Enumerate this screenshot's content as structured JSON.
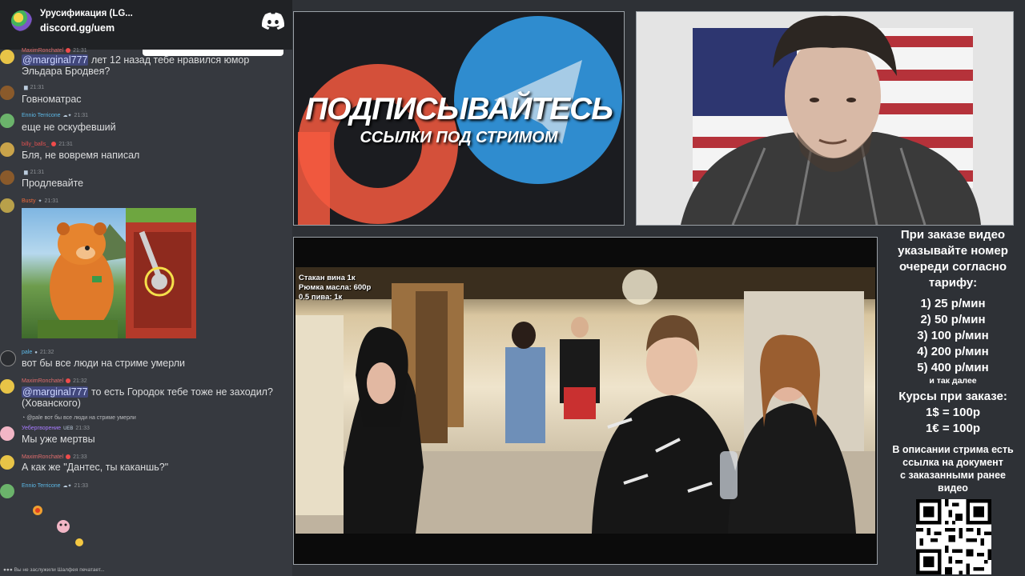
{
  "chat": {
    "server_name": "Урусификация (LG...",
    "server_invite": "discord.gg/uem",
    "messages": [
      {
        "author": "MaximRonchatel",
        "time": "21:31",
        "mention": "@marginal777",
        "text": " лет 12 назад тебе нравился юмор Эльдара Бродвея?"
      },
      {
        "author": "",
        "time": "21:31",
        "text": "Говноматрас"
      },
      {
        "author": "Ennio Terricone",
        "time": "21:31",
        "text": "еще не оскуфевший"
      },
      {
        "author": "billy_balls_",
        "time": "21:31",
        "text": "Бля, не вовремя написал"
      },
      {
        "author": "",
        "time": "21:31",
        "text": "Продлевайте"
      },
      {
        "author": "Busty",
        "time": "21:31",
        "text": ""
      },
      {
        "author": "pale",
        "time": "21:32",
        "text": "вот бы все люди на стриме умерли"
      },
      {
        "author": "MaximRonchatel",
        "time": "21:32",
        "mention": "@marginal777",
        "text": " то есть Городок тебе тоже не заходил? (Хованского)"
      },
      {
        "author": "Уебергворение",
        "tag": "UEB",
        "time": "21:33",
        "reply": "@pale вот бы все люди на стриме умерли",
        "text": "Мы уже мертвы"
      },
      {
        "author": "MaximRonchatel",
        "time": "21:33",
        "text": "А как же \"Дантес, ты каканшь?\""
      },
      {
        "author": "Ennio Terricone",
        "time": "21:33",
        "text": ""
      }
    ],
    "typing": "Вы не заслужили Шалфея печатает..."
  },
  "promo": {
    "headline": "ПОДПИСЫВАЙТЕСЬ",
    "subline": "ССЫЛКИ ПОД СТРИМОМ"
  },
  "video": {
    "overlay_lines": [
      "Стакан вина 1к",
      "Рюмка масла: 600р",
      "0.5 пива: 1к"
    ]
  },
  "info": {
    "heading": [
      "При заказе видео",
      "указывайте номер",
      "очереди согласно",
      "тарифу:"
    ],
    "tariffs": [
      "1) 25 р/мин",
      "2) 50 р/мин",
      "3) 100 р/мин",
      "4) 200 р/мин",
      "5) 400 р/мин"
    ],
    "tariffs_more": "и так далее",
    "rates_heading": "Курсы при заказе:",
    "rates": [
      "1$ = 100р",
      "1€ = 100р"
    ],
    "description": [
      "В описании стрима есть",
      "ссылка на документ",
      "с заказанными ранее",
      "видео"
    ]
  },
  "colors": {
    "discord_blurple": "#5865f2",
    "telegram_blue": "#2f8ccf",
    "patreon_orange": "#f4593f"
  }
}
